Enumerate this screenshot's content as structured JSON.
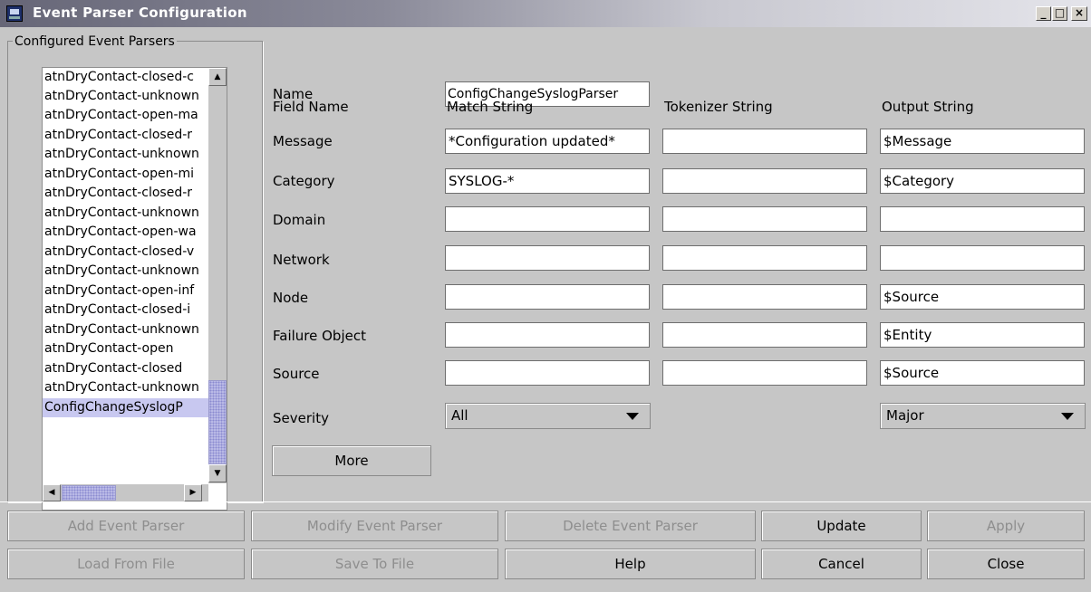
{
  "window": {
    "title": "Event Parser Configuration",
    "minimize_label": "_",
    "maximize_label": "□",
    "close_label": "×"
  },
  "parsers_panel": {
    "title": "Configured Event Parsers",
    "items": [
      "atnDryContact-closed-c",
      "atnDryContact-unknown",
      "atnDryContact-open-ma",
      "atnDryContact-closed-r",
      "atnDryContact-unknown",
      "atnDryContact-open-mi",
      "atnDryContact-closed-r",
      "atnDryContact-unknown",
      "atnDryContact-open-wa",
      "atnDryContact-closed-v",
      "atnDryContact-unknown",
      "atnDryContact-open-inf",
      "atnDryContact-closed-i",
      "atnDryContact-unknown",
      "atnDryContact-open",
      "atnDryContact-closed",
      "atnDryContact-unknown",
      "ConfigChangeSyslogP"
    ],
    "selected_index": 17,
    "scroll_up": "▲",
    "scroll_down": "▼",
    "scroll_left": "◀",
    "scroll_right": "▶"
  },
  "form": {
    "name_label": "Name",
    "name_value": "ConfigChangeSyslogParser",
    "headers": {
      "field_name": "Field Name",
      "match": "Match String",
      "tokenizer": "Tokenizer String",
      "output": "Output String"
    },
    "rows": [
      {
        "label": "Message",
        "match": "*Configuration updated*",
        "tokenizer": "",
        "output": "$Message"
      },
      {
        "label": "Category",
        "match": "SYSLOG-*",
        "tokenizer": "",
        "output": "$Category"
      },
      {
        "label": "Domain",
        "match": "",
        "tokenizer": "",
        "output": ""
      },
      {
        "label": "Network",
        "match": "",
        "tokenizer": "",
        "output": ""
      },
      {
        "label": "Node",
        "match": "",
        "tokenizer": "",
        "output": "$Source"
      },
      {
        "label": "Failure Object",
        "match": "",
        "tokenizer": "",
        "output": "$Entity"
      },
      {
        "label": "Source",
        "match": "",
        "tokenizer": "",
        "output": "$Source"
      }
    ],
    "severity_label": "Severity",
    "severity_match": "All",
    "severity_output": "Major",
    "more_label": "More"
  },
  "buttons": {
    "add": "Add Event Parser",
    "modify": "Modify Event Parser",
    "delete": "Delete Event Parser",
    "update": "Update",
    "apply": "Apply",
    "load": "Load From File",
    "save": "Save To File",
    "help": "Help",
    "cancel": "Cancel",
    "close": "Close"
  }
}
